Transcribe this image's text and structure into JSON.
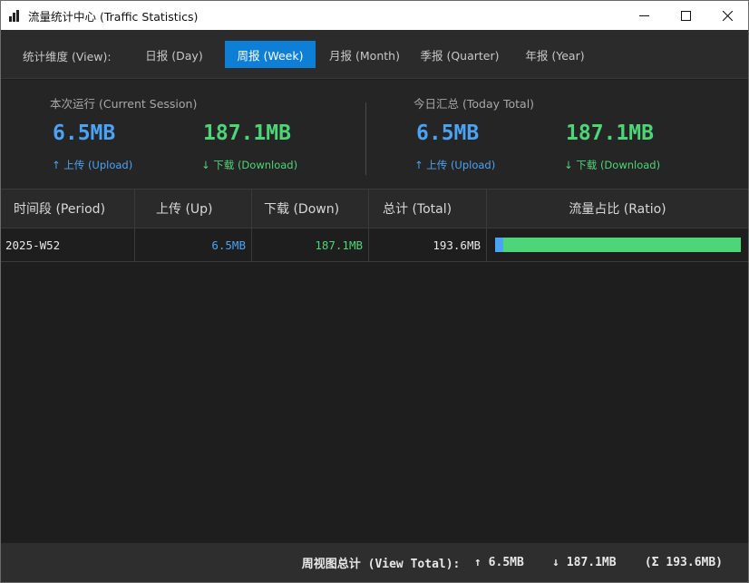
{
  "window": {
    "title": "流量统计中心 (Traffic Statistics)",
    "controls": {
      "minimize_icon": "minimize-icon",
      "maximize_icon": "maximize-icon",
      "close_icon": "close-icon"
    }
  },
  "tabs": {
    "view_label": "统计维度 (View):",
    "items": [
      {
        "label": "日报 (Day)",
        "active": false
      },
      {
        "label": "周报 (Week)",
        "active": true
      },
      {
        "label": "月报 (Month)",
        "active": false
      },
      {
        "label": "季报 (Quarter)",
        "active": false
      },
      {
        "label": "年报 (Year)",
        "active": false
      }
    ]
  },
  "stats": {
    "session": {
      "title": "本次运行 (Current Session)",
      "upload_value": "6.5MB",
      "upload_label": "↑ 上传 (Upload)",
      "download_value": "187.1MB",
      "download_label": "↓ 下载 (Download)"
    },
    "today": {
      "title": "今日汇总 (Today Total)",
      "upload_value": "6.5MB",
      "upload_label": "↑ 上传 (Upload)",
      "download_value": "187.1MB",
      "download_label": "↓ 下载 (Download)"
    }
  },
  "table": {
    "headers": [
      "时间段 (Period)",
      "上传 (Up)",
      "下载 (Down)",
      "总计 (Total)",
      "流量占比 (Ratio)"
    ],
    "rows": [
      {
        "period": "2025-W52",
        "up": "6.5MB",
        "down": "187.1MB",
        "total": "193.6MB",
        "up_ratio": 0.0336,
        "down_ratio": 0.9664
      }
    ]
  },
  "footer": {
    "label": "周视图总计 (View Total):",
    "up": "↑ 6.5MB",
    "down": "↓ 187.1MB",
    "total": "(Σ 193.6MB)"
  },
  "colors": {
    "accent": "#0e7fd6",
    "upload": "#4aa3f5",
    "download": "#4cd677",
    "background": "#1e1e1e"
  }
}
